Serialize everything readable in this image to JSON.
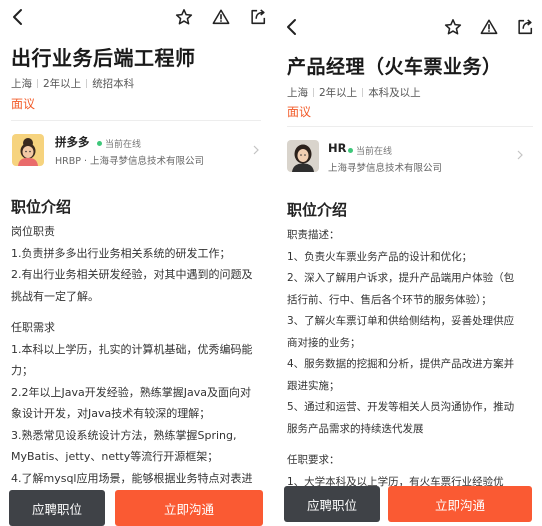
{
  "left": {
    "job_title": "出行业务后端工程师",
    "meta": [
      "上海",
      "2年以上",
      "统招本科"
    ],
    "salary": "面议",
    "recruiter": {
      "name": "拼多多",
      "status": "当前在线",
      "company": "HRBP · 上海寻梦信息技术有限公司"
    },
    "section_title": "职位介绍",
    "description": [
      "岗位职责",
      "1.负责拼多多出行业务相关系统的研发工作；",
      "2.有出行业务相关研发经验，对其中遇到的问题及",
      "挑战有一定了解。",
      "",
      "任职需求",
      "1.本科以上学历，扎实的计算机基础，优秀编码能",
      "力；",
      "2.2年以上Java开发经验，熟练掌握Java及面向对",
      "象设计开发，对Java技术有较深的理解；",
      "3.熟悉常见设系统设计方法，熟练掌握Spring,",
      "MyBatis、jetty、netty等流行开源框架；",
      "4.了解mysql应用场景，能够根据业务特点对表进"
    ],
    "apply_button": "应聘职位",
    "chat_button": "立即沟通"
  },
  "right": {
    "job_title": "产品经理（火车票业务）",
    "meta": [
      "上海",
      "2年以上",
      "本科及以上"
    ],
    "salary": "面议",
    "recruiter": {
      "name": "HR",
      "status": "当前在线",
      "company": "上海寻梦信息技术有限公司"
    },
    "section_title": "职位介绍",
    "description": [
      "职责描述：",
      "1、负责火车票业务产品的设计和优化；",
      "2、深入了解用户诉求，提升产品端用户体验（包",
      "括行前、行中、售后各个环节的服务体验）；",
      "3、了解火车票订单和供给侧结构，妥善处理供应",
      "商对接的业务；",
      "4、服务数据的挖掘和分析，提供产品改进方案并",
      "跟进实施；",
      "5、通过和运营、开发等相关人员沟通协作，推动",
      "服务产品需求的持续迭代发展",
      "",
      "任职要求：",
      "1、大学本科及以上学历，有火车票行业经验优"
    ],
    "apply_button": "应聘职位",
    "chat_button": "立即沟通"
  },
  "colors": {
    "accent": "#fa5a33",
    "salary": "#f25c2a",
    "dark_button": "#3f4247",
    "online": "#3ec77a"
  },
  "icons": [
    "back-icon",
    "star-icon",
    "report-icon",
    "share-icon",
    "chevron-right-icon"
  ]
}
